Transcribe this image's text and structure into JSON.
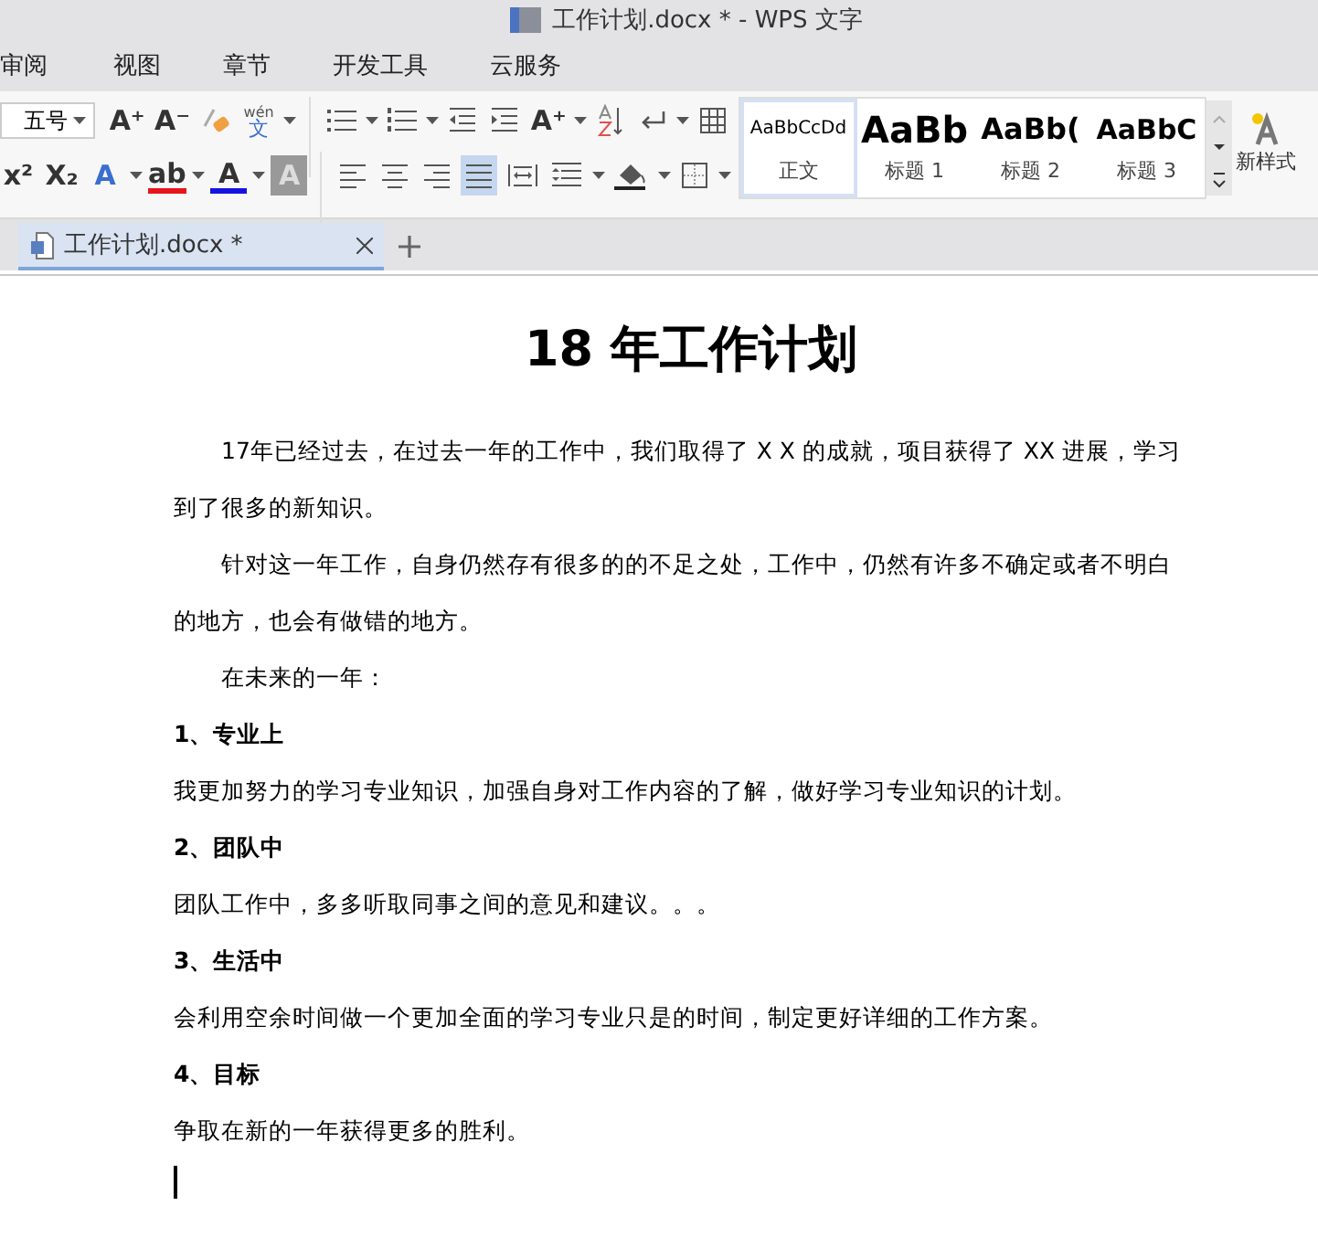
{
  "window": {
    "title": "工作计划.docx * - WPS 文字"
  },
  "menu_tabs": [
    {
      "label": "审阅",
      "selected": false
    },
    {
      "label": "视图",
      "selected": false
    },
    {
      "label": "章节",
      "selected": false
    },
    {
      "label": "开发工具",
      "selected": false
    },
    {
      "label": "云服务",
      "selected": false
    }
  ],
  "ribbon": {
    "font_size": {
      "value": "五号"
    },
    "row1": [
      {
        "kind": "glyph",
        "text": "A⁺",
        "menu": false,
        "selected": false
      },
      {
        "kind": "glyph",
        "text": "A⁻",
        "menu": false,
        "selected": false
      },
      {
        "kind": "eraser",
        "menu": false,
        "selected": false
      },
      {
        "kind": "pinyin",
        "top": "wén",
        "bottom": "文",
        "menu": true,
        "selected": false
      },
      {
        "kind": "sep"
      },
      {
        "kind": "bullets",
        "menu": true,
        "selected": false
      },
      {
        "kind": "numbering",
        "menu": true,
        "selected": false
      },
      {
        "kind": "outdent",
        "menu": false,
        "selected": false
      },
      {
        "kind": "indent",
        "menu": false,
        "selected": false
      },
      {
        "kind": "glyph",
        "text": "A⁺",
        "menu": true,
        "selected": false
      },
      {
        "kind": "sort",
        "menu": false,
        "selected": false
      },
      {
        "kind": "linebreak",
        "menu": true,
        "selected": false
      },
      {
        "kind": "table",
        "menu": false,
        "selected": false
      }
    ],
    "row2": [
      {
        "kind": "glyph",
        "text": "x²",
        "menu": false,
        "selected": false
      },
      {
        "kind": "glyph",
        "text": "X₂",
        "menu": false,
        "selected": false
      },
      {
        "kind": "outline-a",
        "text": "A",
        "menu": true,
        "selected": false
      },
      {
        "kind": "highlight",
        "text": "ab",
        "color": "#e8141c",
        "menu": true,
        "selected": false
      },
      {
        "kind": "fontcolor",
        "text": "A",
        "color": "#1414e0",
        "menu": true,
        "selected": false
      },
      {
        "kind": "shade-a",
        "text": "A",
        "menu": false,
        "selected": false
      },
      {
        "kind": "sep"
      },
      {
        "kind": "align-left",
        "menu": false,
        "selected": false
      },
      {
        "kind": "align-center",
        "menu": false,
        "selected": false
      },
      {
        "kind": "align-right",
        "menu": false,
        "selected": false
      },
      {
        "kind": "align-justify",
        "menu": false,
        "selected": true
      },
      {
        "kind": "align-distribute",
        "menu": false,
        "selected": false
      },
      {
        "kind": "linespacing",
        "menu": true,
        "selected": false
      },
      {
        "kind": "fill",
        "menu": true,
        "selected": false
      },
      {
        "kind": "border",
        "menu": true,
        "selected": false
      }
    ],
    "styles": [
      {
        "preview": "AaBbCcDd",
        "name": "正文",
        "kind": "normal",
        "selected": true
      },
      {
        "preview": "AaBb",
        "name": "标题 1",
        "kind": "h1",
        "selected": false
      },
      {
        "preview": "AaBb(",
        "name": "标题 2",
        "kind": "h2",
        "selected": false
      },
      {
        "preview": "AaBbC",
        "name": "标题 3",
        "kind": "h3",
        "selected": false
      }
    ],
    "new_style": {
      "label": "新样式"
    }
  },
  "doc_tabs": [
    {
      "label": "工作计划.docx *",
      "selected": true
    }
  ],
  "document": {
    "title": "18 年工作计划",
    "paragraphs": [
      {
        "kind": "indent",
        "text": "17年已经过去，在过去一年的工作中，我们取得了 X X 的成就，项目获得了 XX 进展，学习到了很多的新知识。"
      },
      {
        "kind": "indent",
        "text": "针对这一年工作，自身仍然存有很多的的不足之处，工作中，仍然有许多不确定或者不明白的地方，也会有做错的地方。"
      },
      {
        "kind": "indent",
        "text": "在未来的一年："
      },
      {
        "kind": "heading",
        "text": "1、专业上"
      },
      {
        "kind": "plain",
        "text": "我更加努力的学习专业知识，加强自身对工作内容的了解，做好学习专业知识的计划。"
      },
      {
        "kind": "heading",
        "text": "2、团队中"
      },
      {
        "kind": "plain",
        "text": "团队工作中，多多听取同事之间的意见和建议。。。"
      },
      {
        "kind": "heading",
        "text": "3、生活中"
      },
      {
        "kind": "plain",
        "text": "会利用空余时间做一个更加全面的学习专业只是的时间，制定更好详细的工作方案。"
      },
      {
        "kind": "heading",
        "text": "4、目标"
      },
      {
        "kind": "plain",
        "text": "争取在新的一年获得更多的胜利。"
      }
    ]
  }
}
